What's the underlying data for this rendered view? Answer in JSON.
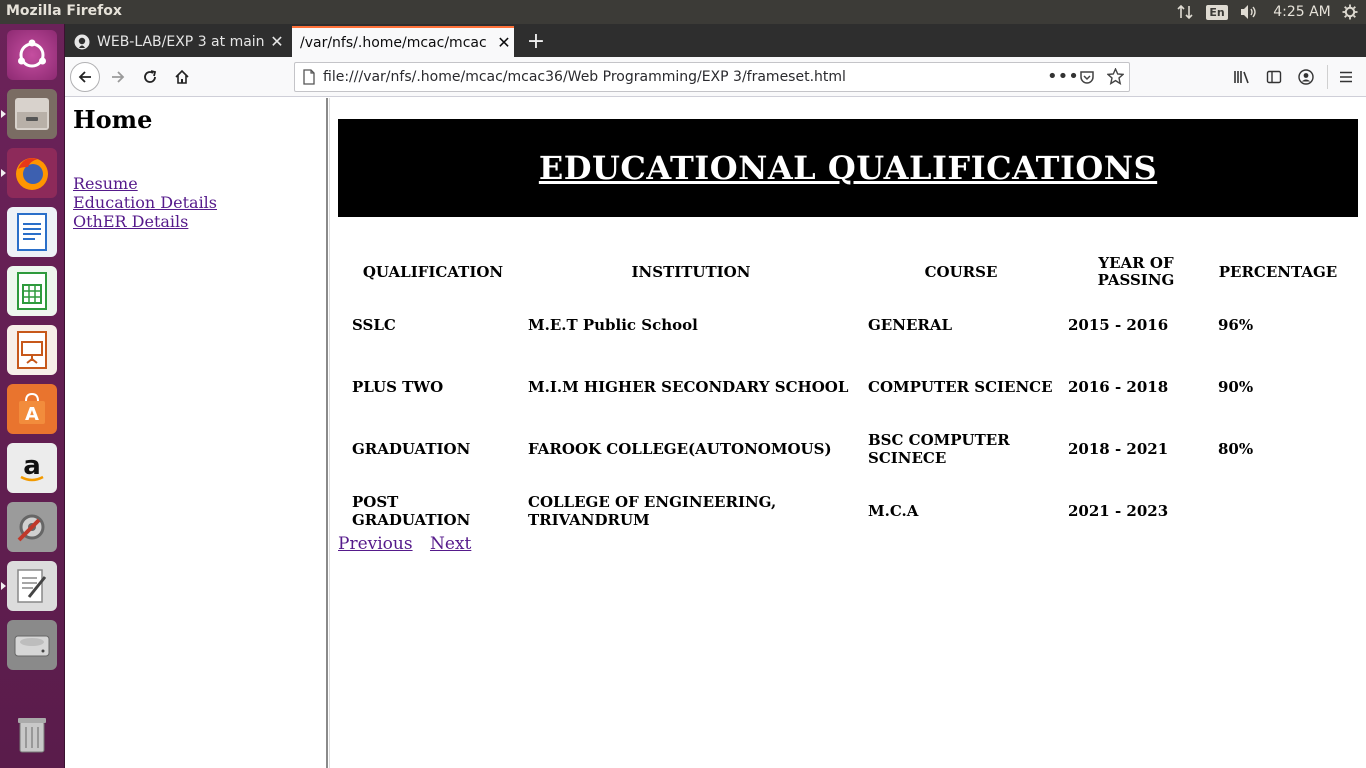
{
  "top_panel": {
    "app_title": "Mozilla Firefox",
    "language": "En",
    "time": "4:25 AM",
    "icons": [
      "network-arrows-icon",
      "volume-icon",
      "settings-gear-icon"
    ]
  },
  "launcher": {
    "items": [
      "ubuntu-dash-icon",
      "files-icon",
      "firefox-icon",
      "writer-icon",
      "calc-icon",
      "impress-icon",
      "software-center-icon",
      "amazon-icon",
      "system-settings-icon",
      "text-editor-icon",
      "disk-icon",
      "trash-icon"
    ]
  },
  "browser": {
    "tabs": [
      {
        "label": "WEB-LAB/EXP 3 at main"
      },
      {
        "label": "/var/nfs/.home/mcac/mcac"
      }
    ],
    "url": "file:///var/nfs/.home/mcac/mcac36/Web Programming/EXP 3/frameset.html"
  },
  "left_frame": {
    "title": "Home",
    "links": [
      "Resume",
      "Education Details",
      "OthER Details"
    ]
  },
  "right_frame": {
    "heading": "EDUCATIONAL QUALIFICATIONS",
    "table": {
      "headers": [
        "QUALIFICATION",
        "INSTITUTION",
        "COURSE",
        "YEAR OF PASSING",
        "PERCENTAGE"
      ],
      "rows": [
        [
          "SSLC",
          "M.E.T Public School",
          "GENERAL",
          "2015 - 2016",
          "96%"
        ],
        [
          "PLUS TWO",
          "M.I.M HIGHER SECONDARY SCHOOL",
          "COMPUTER SCIENCE",
          "2016 - 2018",
          "90%"
        ],
        [
          "GRADUATION",
          "FAROOK COLLEGE(AUTONOMOUS)",
          "BSC COMPUTER SCINECE",
          "2018 - 2021",
          "80%"
        ],
        [
          "POST GRADUATION",
          "COLLEGE OF ENGINEERING, TRIVANDRUM",
          "M.C.A",
          "2021 - 2023",
          ""
        ]
      ]
    },
    "pager": {
      "previous": "Previous",
      "next": "Next"
    }
  },
  "colors": {
    "launcher_bg": "#6b2259",
    "panel_bg": "#3c3b37",
    "link_visited": "#551a8b",
    "banner_bg": "#000000"
  }
}
